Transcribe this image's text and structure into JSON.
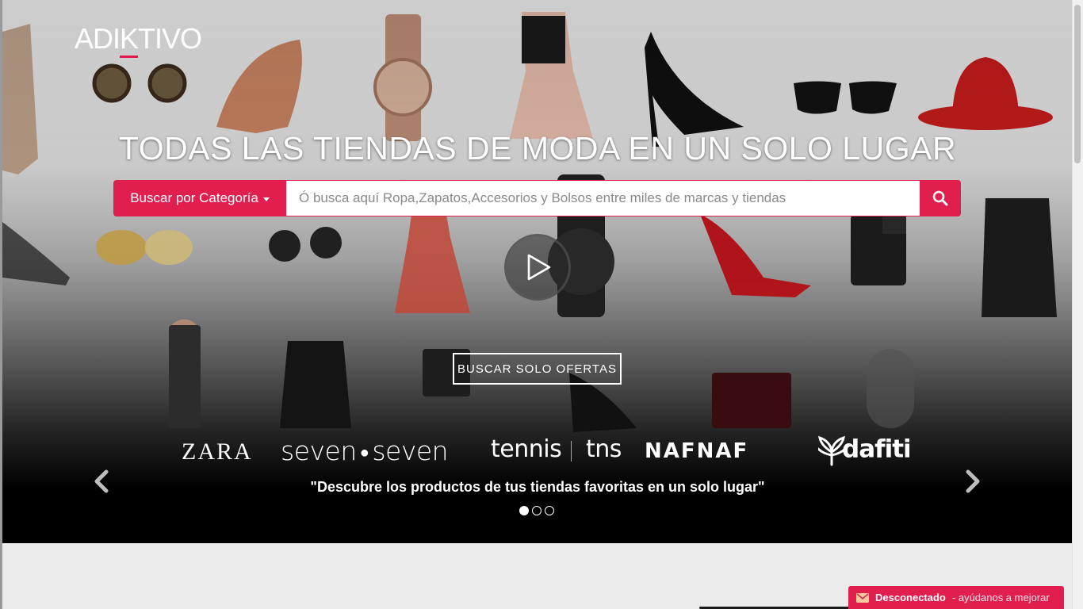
{
  "header": {
    "logo_text_1": "ADI",
    "logo_text_k": "K",
    "logo_text_2": "TIVO"
  },
  "hero": {
    "headline": "TODAS LAS TIENDAS DE MODA EN UN SOLO LUGAR",
    "category_button": "Buscar por Categoría",
    "search_placeholder": "Ó busca aquí Ropa,Zapatos,Accesorios y Bolsos entre miles de marcas y tiendas",
    "offers_button": "BUSCAR SOLO OFERTAS",
    "tagline": "\"Descubre los productos de tus tiendas favoritas en un solo lugar\""
  },
  "brands": {
    "zara": "ZARA",
    "seven_a": "seven",
    "seven_b": "seven",
    "tennis": "tennis",
    "tns": "tns",
    "nafnaf": "NAFNAF",
    "dafiti": "dafiti"
  },
  "carousel": {
    "slides": 3,
    "active": 0
  },
  "feedback": {
    "status": "Desconectado",
    "label": "- ayúdanos a mejorar"
  },
  "colors": {
    "accent": "#e01f4f",
    "hero_dark": "#000000",
    "below_bg": "#ebebeb"
  }
}
